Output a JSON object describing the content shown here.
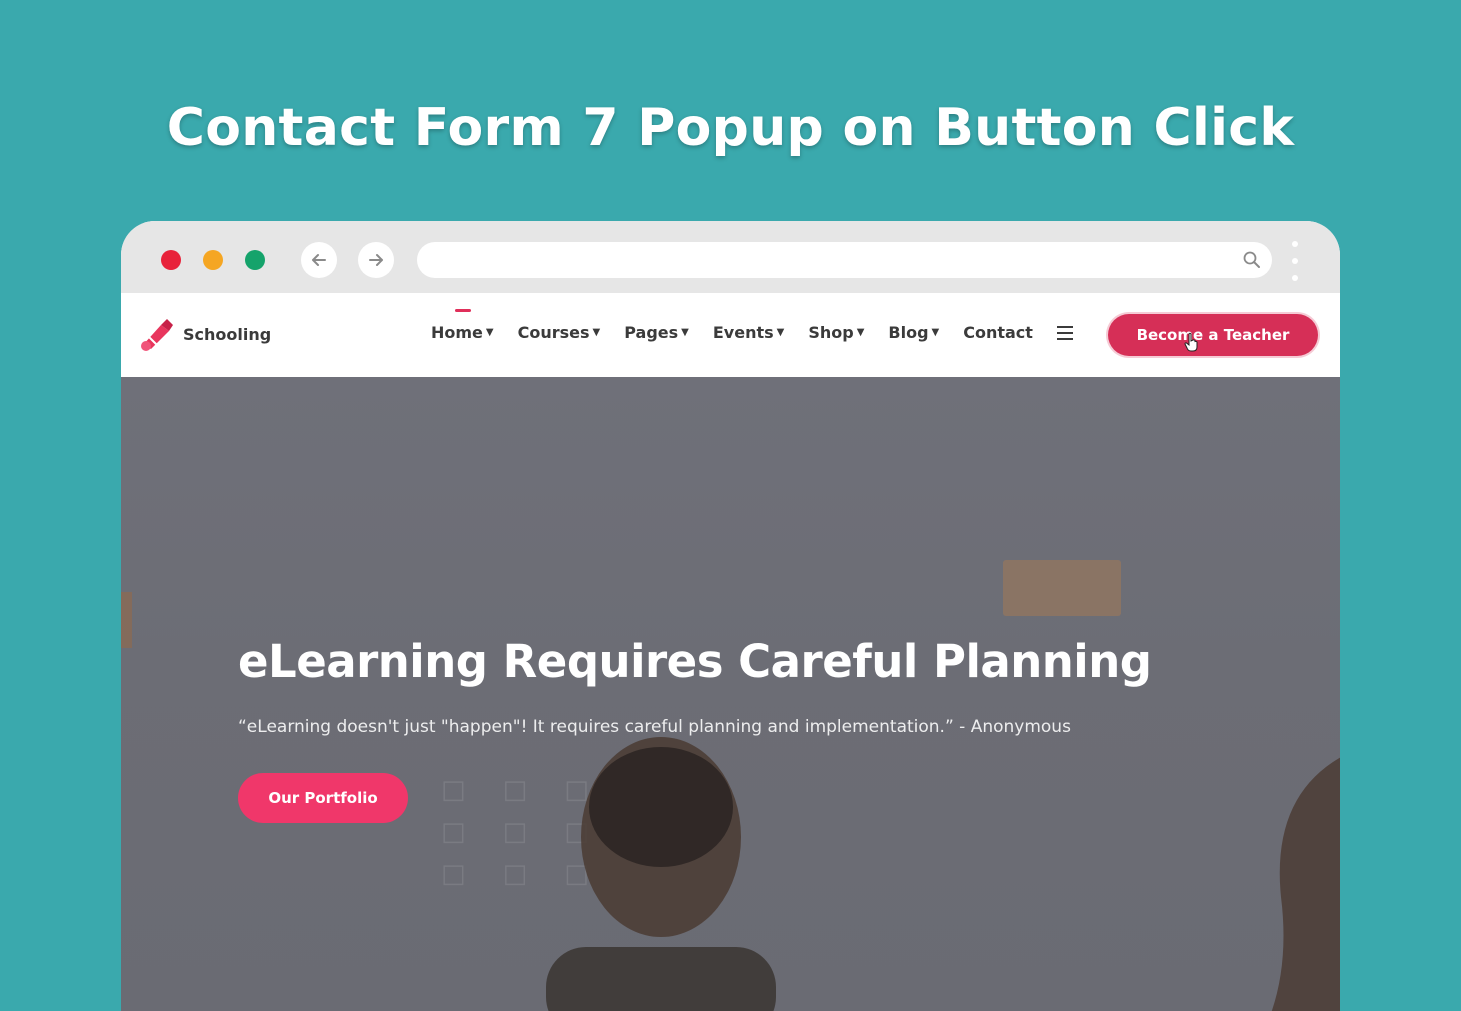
{
  "page_heading": "Contact Form 7 Popup on Button Click",
  "browser": {
    "url": "",
    "icons": {
      "back": "arrow-left-icon",
      "forward": "arrow-right-icon",
      "search": "search-icon",
      "menu": "kebab-icon"
    }
  },
  "site": {
    "logo_text": "Schooling",
    "menu": [
      {
        "label": "Home",
        "has_dropdown": true,
        "active": true
      },
      {
        "label": "Courses",
        "has_dropdown": true
      },
      {
        "label": "Pages",
        "has_dropdown": true
      },
      {
        "label": "Events",
        "has_dropdown": true
      },
      {
        "label": "Shop",
        "has_dropdown": true
      },
      {
        "label": "Blog",
        "has_dropdown": true
      },
      {
        "label": "Contact",
        "has_dropdown": false
      }
    ],
    "cta_label": "Become a Teacher",
    "hero": {
      "title": "eLearning Requires Careful Planning",
      "quote": "“eLearning doesn't just \"happen\"! It requires careful planning and implementation.” - Anonymous",
      "button_label": "Our Portfolio"
    }
  },
  "colors": {
    "background": "#3aa9ad",
    "accent": "#d62f57",
    "button_pink": "#f0376a",
    "traffic_red": "#e8223a",
    "traffic_yellow": "#f5a623",
    "traffic_green": "#15a36b"
  }
}
